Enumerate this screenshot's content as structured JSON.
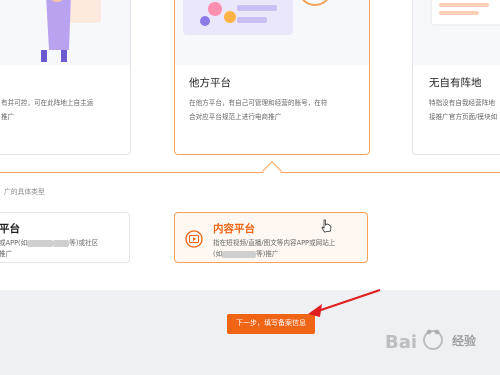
{
  "cards": [
    {
      "title": "",
      "desc_lines": [
        "在此平台上自主运",
        "推广"
      ]
    },
    {
      "title": "他方平台",
      "desc_lines": [
        "在他方平台，有自己可管理和经营的账号，在符",
        "合对应平台规范上进行电商推广"
      ]
    },
    {
      "title": "无自有阵地",
      "desc_lines": [
        "特指没有自我经营阵地",
        "接推广官方页面/模块如"
      ]
    }
  ],
  "left_card_partial": "有并可控，可在此阵地上自主运",
  "section_label": "广的具体类型",
  "type_cards": [
    {
      "title": "平台",
      "desc_line1": "或APP(如",
      "desc_line1_tail": "等)或社区",
      "desc_line2": "推广"
    },
    {
      "title": "内容平台",
      "desc_line1": "指在短视频/直播/图文等内容APP或网站上",
      "desc_line2_pre": "(如",
      "desc_line2_post": "等)推广"
    }
  ],
  "next_button": "下一步，填写备案信息",
  "watermark": "经验",
  "colors": {
    "accent": "#f06416",
    "border_accent": "#f5a15a",
    "arrow": "#e02020"
  }
}
